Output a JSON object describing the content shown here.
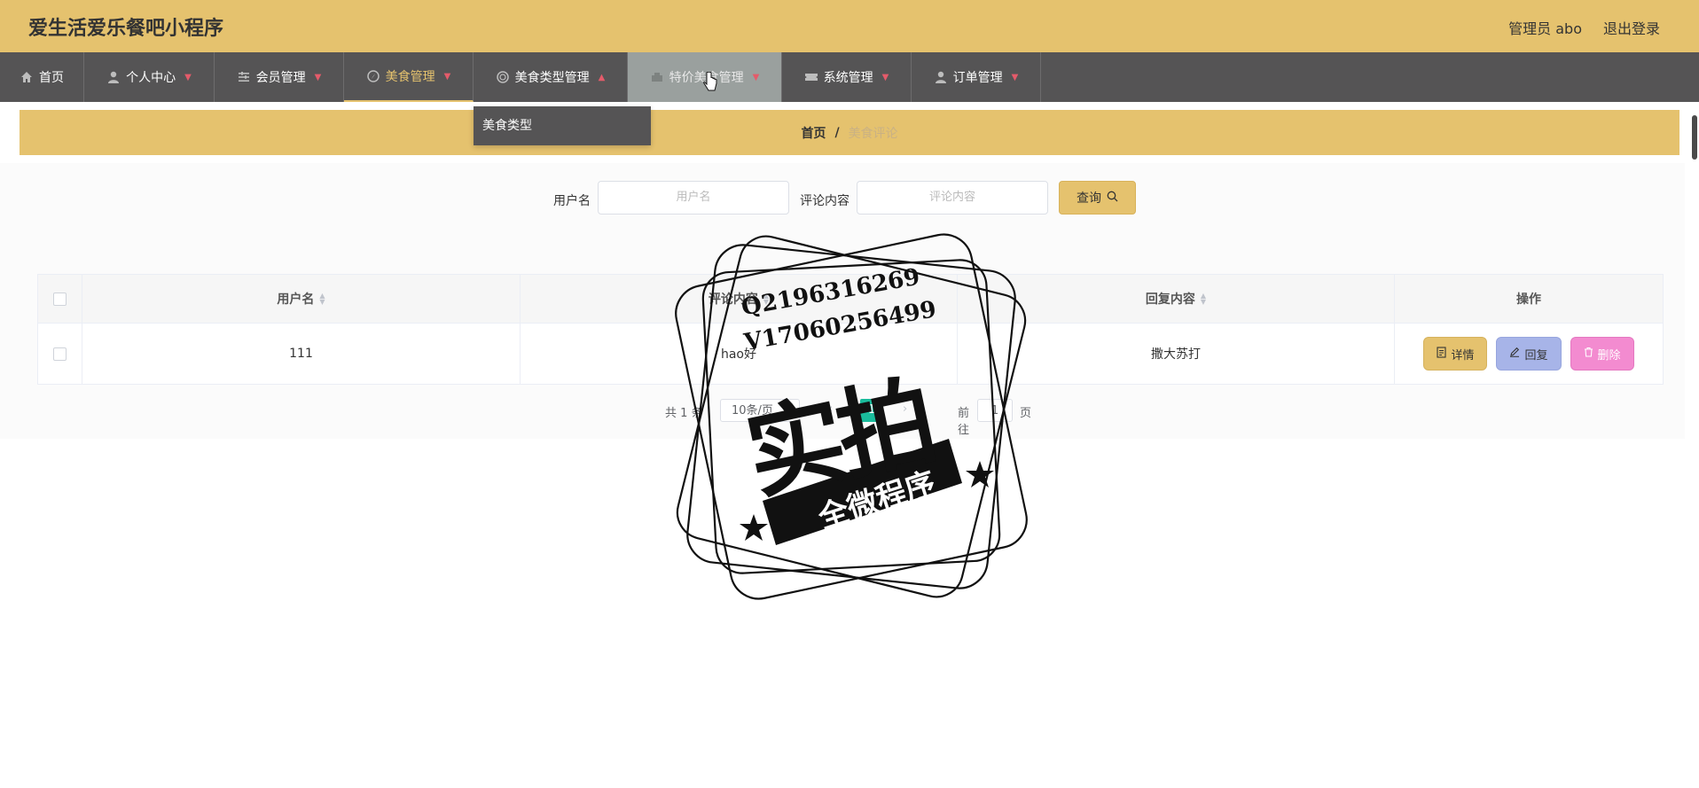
{
  "app": {
    "title": "爱生活爱乐餐吧小程序",
    "admin": "管理员 abo",
    "logout": "退出登录"
  },
  "nav": [
    {
      "label": "首页",
      "icon": "home-icon"
    },
    {
      "label": "个人中心",
      "icon": "user-icon"
    },
    {
      "label": "会员管理",
      "icon": "sliders-icon"
    },
    {
      "label": "美食管理",
      "icon": "compass-icon"
    },
    {
      "label": "美食类型管理",
      "icon": "circle-icon"
    },
    {
      "label": "特价美食管理",
      "icon": "tag-icon"
    },
    {
      "label": "系统管理",
      "icon": "ticket-icon"
    },
    {
      "label": "订单管理",
      "icon": "user-icon"
    }
  ],
  "dropdown": {
    "item": "美食类型"
  },
  "breadcrumb": {
    "home": "首页",
    "sep": "/",
    "current": "美食评论"
  },
  "search": {
    "username_label": "用户名",
    "username_placeholder": "用户名",
    "comment_label": "评论内容",
    "comment_placeholder": "评论内容",
    "button": "查询"
  },
  "table": {
    "headers": [
      "用户名",
      "评论内容",
      "回复内容",
      "操作"
    ],
    "rows": [
      {
        "username": "111",
        "comment": "hao好",
        "reply": "撒大苏打"
      }
    ],
    "actions": {
      "detail": "详情",
      "reply": "回复",
      "delete": "删除"
    }
  },
  "pagination": {
    "total_prefix": "共",
    "total": "1",
    "total_suffix": "条",
    "page_size": "10条/页",
    "current": "1",
    "goto": "前往",
    "jump": "1",
    "unit": "页"
  },
  "watermark": {
    "qq": "Q2196316269",
    "vx": "V17060256499",
    "main": "实拍",
    "sub": "全微程序"
  },
  "colors": {
    "accent": "#e5c26e",
    "nav_bg": "#555455",
    "active_page": "#1abc9c"
  }
}
